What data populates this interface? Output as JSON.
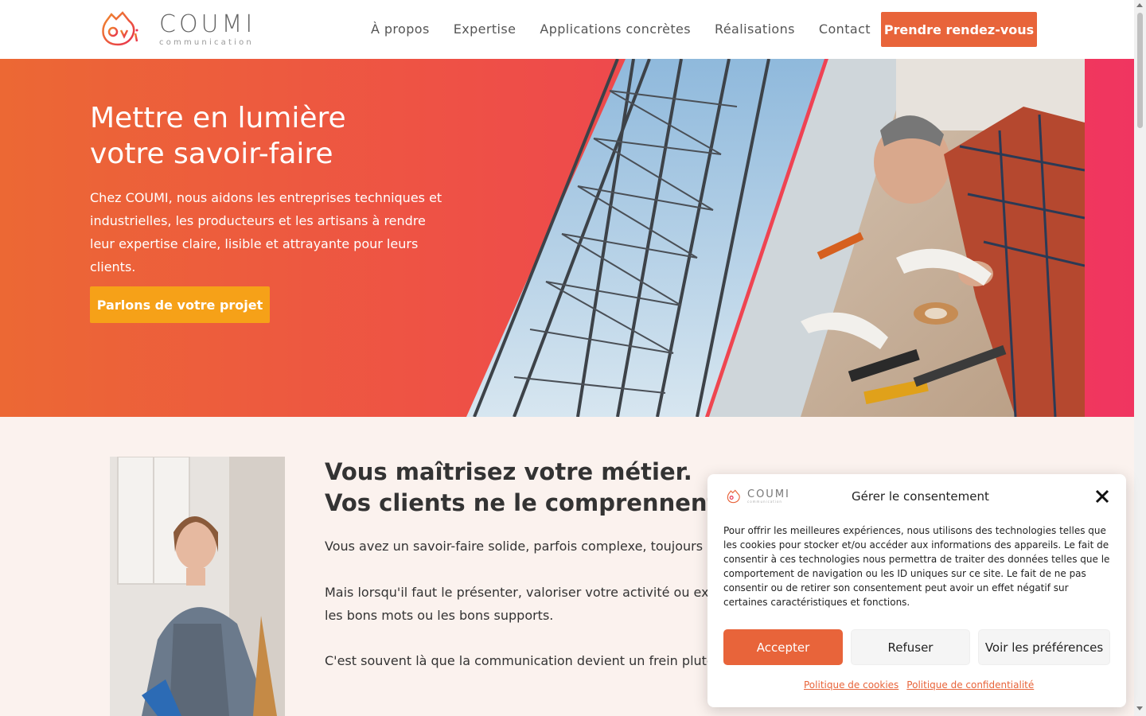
{
  "brand": {
    "name": "COUMI",
    "tagline": "communication"
  },
  "nav": {
    "items": [
      {
        "label": "À propos"
      },
      {
        "label": "Expertise"
      },
      {
        "label": "Applications concrètes"
      },
      {
        "label": "Réalisations"
      },
      {
        "label": "Contact"
      }
    ],
    "cta": "Prendre rendez-vous"
  },
  "hero": {
    "title_line1": "Mettre en lumière",
    "title_line2": "votre savoir-faire",
    "text": "Chez COUMI, nous aidons les entreprises techniques et industrielles, les producteurs et les artisans à rendre leur expertise claire, lisible et attrayante pour leurs clients.",
    "cta": "Parlons de votre projet"
  },
  "section": {
    "title_line1": "Vous maîtrisez votre métier.",
    "title_line2": "Vos clients ne le comprennent pas",
    "p1": "Vous avez un savoir-faire solide, parfois complexe, toujours pas",
    "p2_line1": "Mais lorsqu'il faut le présenter, valoriser votre activité ou expliqu",
    "p2_line2": "les bons mots ou les bons supports.",
    "p3": "C'est souvent là que la communication devient un frein plutôt qu"
  },
  "consent": {
    "logo_name": "COUMI",
    "logo_sub": "communication",
    "title": "Gérer le consentement",
    "text": "Pour offrir les meilleures expériences, nous utilisons des technologies telles que les cookies pour stocker et/ou accéder aux informations des appareils. Le fait de consentir à ces technologies nous permettra de traiter des données telles que le comportement de navigation ou les ID uniques sur ce site. Le fait de ne pas consentir ou de retirer son consentement peut avoir un effet négatif sur certaines caractéristiques et fonctions.",
    "accept": "Accepter",
    "refuse": "Refuser",
    "preferences": "Voir les préférences",
    "link_cookies": "Politique de cookies",
    "link_privacy": "Politique de confidentialité"
  },
  "colors": {
    "accent": "#e8643a",
    "hero_start": "#ec6834",
    "hero_end": "#f03560",
    "cta_yellow": "#f6a118",
    "section_bg": "#fbf2ee"
  },
  "icons": [
    "coumi-logo-icon",
    "close-icon"
  ]
}
